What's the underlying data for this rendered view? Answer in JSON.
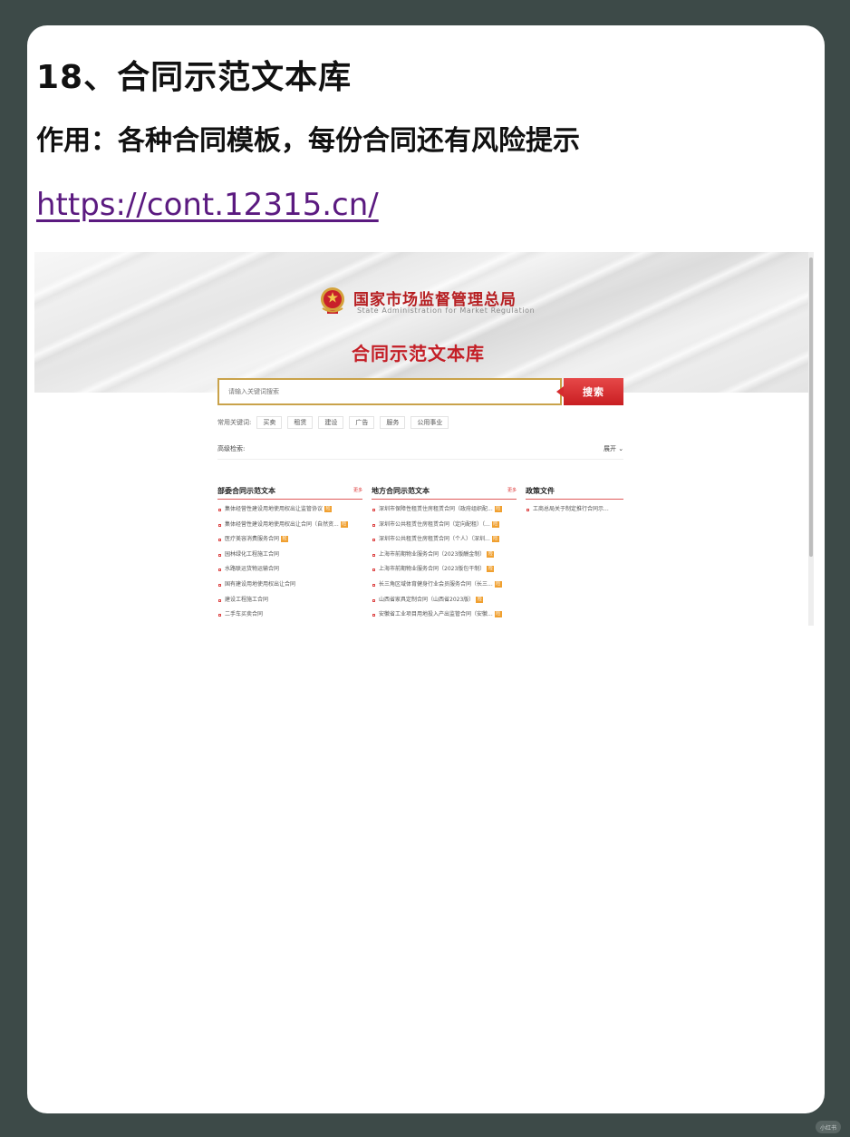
{
  "post": {
    "title": "18、合同示范文本库",
    "purpose": "作用：各种合同模板，每份合同还有风险提示",
    "url": "https://cont.12315.cn/"
  },
  "site": {
    "org_name_cn": "国家市场监督管理总局",
    "org_name_en": "State Administration for Market Regulation",
    "library_title": "合同示范文本库",
    "search_placeholder": "请输入关键词搜索",
    "search_button": "搜索",
    "keywords_label": "常用关键词:",
    "keywords": [
      "买卖",
      "租赁",
      "建设",
      "广告",
      "服务",
      "公用事业"
    ],
    "advanced_search": "高级检索:",
    "expand": "展开 ⌄",
    "columns": [
      {
        "title": "部委合同示范文本",
        "more": "更多",
        "items": [
          {
            "text": "集体经营性建设用地使用权出让监管协议",
            "tag": "险"
          },
          {
            "text": "集体经营性建设用地使用权出让合同（自然资...",
            "tag": "险"
          },
          {
            "text": "医疗美容消费服务合同",
            "tag": "险"
          },
          {
            "text": "园林绿化工程施工合同",
            "tag": ""
          },
          {
            "text": "水路联运货物运输合同",
            "tag": ""
          },
          {
            "text": "国有建设用地使用权出让合同",
            "tag": ""
          },
          {
            "text": "建设工程施工合同",
            "tag": ""
          },
          {
            "text": "二手车买卖合同",
            "tag": ""
          }
        ]
      },
      {
        "title": "地方合同示范文本",
        "more": "更多",
        "items": [
          {
            "text": "深圳市保障性租赁住房租赁合同（政府组织配...",
            "tag": "险"
          },
          {
            "text": "深圳市公共租赁住房租赁合同（定向配租）（...",
            "tag": "险"
          },
          {
            "text": "深圳市公共租赁住房租赁合同（个人）（深圳...",
            "tag": "险"
          },
          {
            "text": "上海市前期物业服务合同（2023版酬金制）",
            "tag": "险"
          },
          {
            "text": "上海市前期物业服务合同（2023版包干制）",
            "tag": "险"
          },
          {
            "text": "长三角区域体育健身行业会员服务合同（长三...",
            "tag": "险"
          },
          {
            "text": "山西省家具定制合同（山西省2023版）",
            "tag": "险"
          },
          {
            "text": "安徽省工业项目用地投入产出监管合同（安徽...",
            "tag": "险"
          }
        ]
      },
      {
        "title": "政策文件",
        "more": "",
        "items": [
          {
            "text": "工商总局关于制定推行合同示...",
            "tag": ""
          }
        ]
      }
    ]
  },
  "watermark": "小红书"
}
